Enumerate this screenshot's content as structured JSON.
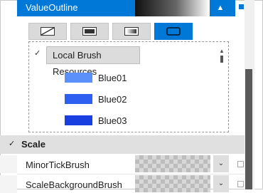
{
  "property_row": {
    "label": "ValueOutline",
    "up_glyph": "▲"
  },
  "brush_types": [
    {
      "name": "no-brush",
      "active": false
    },
    {
      "name": "solid-brush",
      "active": false
    },
    {
      "name": "gradient-brush",
      "active": false
    },
    {
      "name": "resource-brush",
      "active": true
    }
  ],
  "resources": {
    "title": "Local Brush Resources",
    "items": [
      {
        "label": "Blue01",
        "color": "#5b8ff9"
      },
      {
        "label": "Blue02",
        "color": "#2f5ff0"
      },
      {
        "label": "Blue03",
        "color": "#1a3fe0"
      }
    ]
  },
  "scale_section": {
    "title": "Scale",
    "properties": [
      {
        "label": "MinorTickBrush"
      },
      {
        "label": "ScaleBackgroundBrush"
      }
    ]
  },
  "colors": {
    "accent": "#0078d7",
    "panel": "#e0e0e0"
  }
}
